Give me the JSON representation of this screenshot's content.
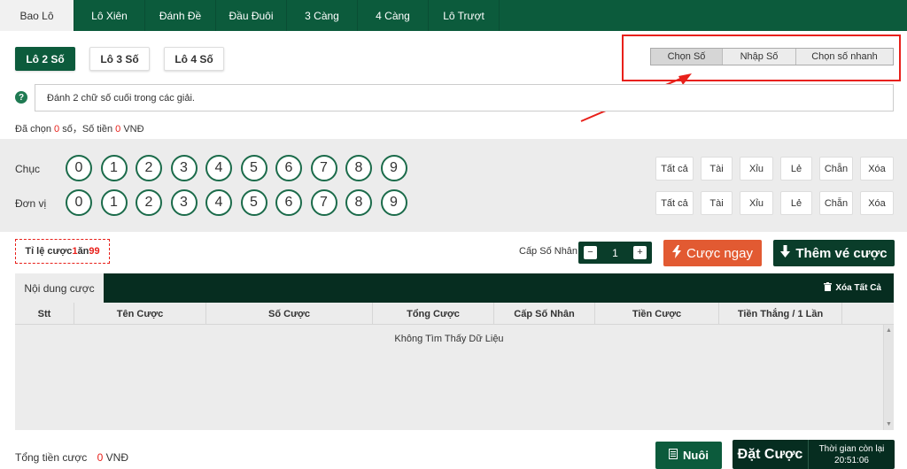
{
  "tabs": [
    "Bao Lô",
    "Lô Xiên",
    "Đánh Đề",
    "Đầu Đuôi",
    "3 Càng",
    "4 Càng",
    "Lô Trượt"
  ],
  "subtabs": [
    "Lô 2 Số",
    "Lô 3 Số",
    "Lô 4 Số"
  ],
  "modes": [
    "Chọn Số",
    "Nhập Số",
    "Chọn số nhanh"
  ],
  "hint": "Đánh 2 chữ số cuối trong các giải.",
  "selected": {
    "prefix": "Đã chọn ",
    "count": "0",
    "mid": " số，Số tiền ",
    "amount": "0",
    "suffix": " VNĐ"
  },
  "picker": {
    "rows": [
      {
        "label": "Chục"
      },
      {
        "label": "Đơn vị"
      }
    ],
    "digits": [
      "0",
      "1",
      "2",
      "3",
      "4",
      "5",
      "6",
      "7",
      "8",
      "9"
    ],
    "quick": [
      "Tất cả",
      "Tài",
      "Xỉu",
      "Lẻ",
      "Chẵn",
      "Xóa"
    ]
  },
  "odds": {
    "prefix": "Tỉ lệ cược ",
    "a": "1",
    "mid": " ăn ",
    "b": "99"
  },
  "multiplier": {
    "label": "Cấp Số Nhân",
    "minus": "−",
    "value": "1",
    "plus": "+"
  },
  "bet_now": "Cược ngay",
  "add_ticket": "Thêm vé cược",
  "table": {
    "title": "Nội dung cược",
    "clear_all": "Xóa Tất Cả",
    "columns": [
      "Stt",
      "Tên Cược",
      "Số Cược",
      "Tổng Cược",
      "Cấp Số Nhân",
      "Tiền Cược",
      "Tiền Thắng / 1 Lần"
    ],
    "empty": "Không Tìm Thấy Dữ Liệu"
  },
  "total": {
    "label": "Tổng tiền cược",
    "amount": "0",
    "unit": " VNĐ"
  },
  "raise": "Nuôi",
  "place_bet": "Đặt Cược",
  "timer": {
    "label": "Thời gian còn lại",
    "value": "20:51:06"
  },
  "colors": {
    "primary": "#0c5b3c",
    "dark": "#062d20",
    "accent": "#e25a32",
    "annotation": "#e8201a"
  }
}
